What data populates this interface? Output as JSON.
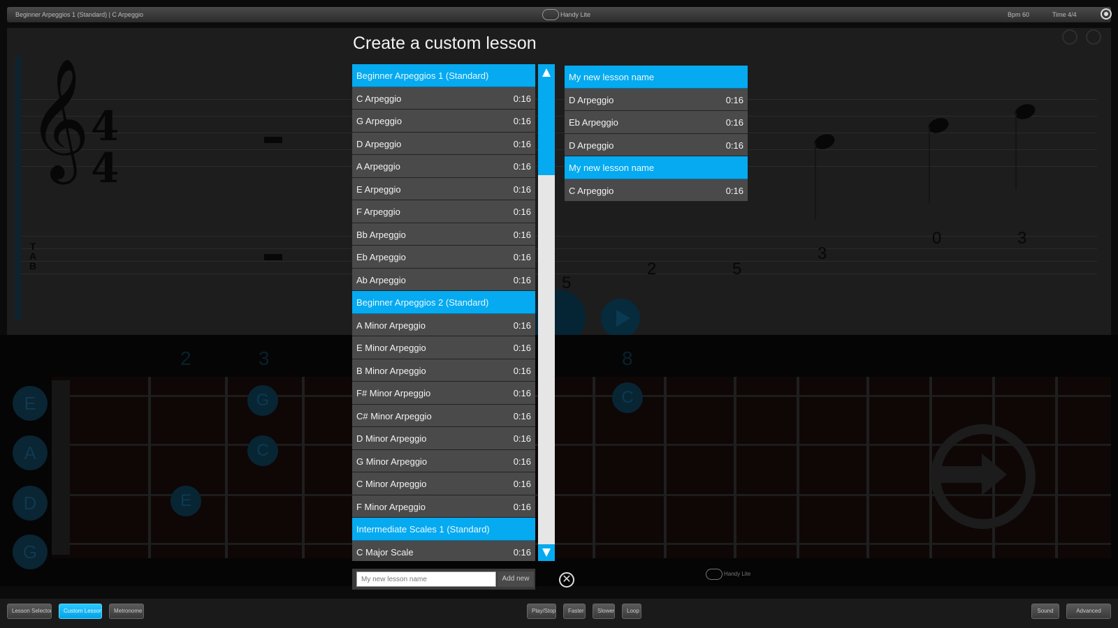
{
  "topbar": {
    "breadcrumb": "Beginner Arpeggios 1 (Standard) | C Arpeggio",
    "center_label": "Handy Lite",
    "bpm": "Bpm 60",
    "time_signature": "Time 4/4"
  },
  "notation": {
    "clef_glyph": "𝄞",
    "time_top": "4",
    "time_bottom": "4",
    "tab_letters": [
      "T",
      "A",
      "B"
    ],
    "tab_numbers": [
      "5",
      "2",
      "5",
      "3",
      "0",
      "3"
    ]
  },
  "fretboard": {
    "fret_numbers": [
      "2",
      "3",
      "8"
    ],
    "string_labels": [
      "E",
      "A",
      "D",
      "G"
    ],
    "dots": [
      "G",
      "C",
      "E",
      "C"
    ],
    "toggle_label": "Handy Lite"
  },
  "modal": {
    "title": "Create a custom lesson",
    "source_list": [
      {
        "name": "Beginner Arpeggios 1 (Standard)",
        "duration": "",
        "header": true
      },
      {
        "name": "C Arpeggio",
        "duration": "0:16"
      },
      {
        "name": "G Arpeggio",
        "duration": "0:16"
      },
      {
        "name": "D Arpeggio",
        "duration": "0:16"
      },
      {
        "name": "A Arpeggio",
        "duration": "0:16"
      },
      {
        "name": "E Arpeggio",
        "duration": "0:16"
      },
      {
        "name": "F Arpeggio",
        "duration": "0:16"
      },
      {
        "name": "Bb Arpeggio",
        "duration": "0:16"
      },
      {
        "name": "Eb Arpeggio",
        "duration": "0:16"
      },
      {
        "name": "Ab Arpeggio",
        "duration": "0:16"
      },
      {
        "name": "Beginner Arpeggios 2 (Standard)",
        "duration": "",
        "header": true
      },
      {
        "name": "A Minor Arpeggio",
        "duration": "0:16"
      },
      {
        "name": "E Minor Arpeggio",
        "duration": "0:16"
      },
      {
        "name": "B Minor Arpeggio",
        "duration": "0:16"
      },
      {
        "name": "F# Minor Arpeggio",
        "duration": "0:16"
      },
      {
        "name": "C# Minor Arpeggio",
        "duration": "0:16"
      },
      {
        "name": "D Minor Arpeggio",
        "duration": "0:16"
      },
      {
        "name": "G Minor Arpeggio",
        "duration": "0:16"
      },
      {
        "name": "C Minor Arpeggio",
        "duration": "0:16"
      },
      {
        "name": "F Minor Arpeggio",
        "duration": "0:16"
      },
      {
        "name": "Intermediate Scales 1 (Standard)",
        "duration": "",
        "header": true
      },
      {
        "name": "C Major Scale",
        "duration": "0:16"
      }
    ],
    "custom_list": [
      {
        "name": "My new lesson name",
        "duration": "",
        "header": true
      },
      {
        "name": "D Arpeggio",
        "duration": "0:16"
      },
      {
        "name": "Eb Arpeggio",
        "duration": "0:16"
      },
      {
        "name": "D Arpeggio",
        "duration": "0:16"
      },
      {
        "name": "My new lesson name",
        "duration": "",
        "header": true
      },
      {
        "name": "C Arpeggio",
        "duration": "0:16"
      }
    ],
    "name_input": {
      "value": "My new lesson name",
      "placeholder": "My new lesson name"
    },
    "add_label": "Add new",
    "close_glyph": "✕"
  },
  "bottombar": {
    "left_buttons": [
      "Lesson Selector",
      "Custom Lesson",
      "Metronome"
    ],
    "center_buttons": [
      "Play/Stop",
      "Faster",
      "Slower",
      "Loop"
    ],
    "right_buttons": [
      "Sound",
      "Advanced"
    ]
  },
  "colors": {
    "accent": "#05aaf0",
    "panel_row": "#4a4a4a",
    "background": "#0b0b0b"
  }
}
